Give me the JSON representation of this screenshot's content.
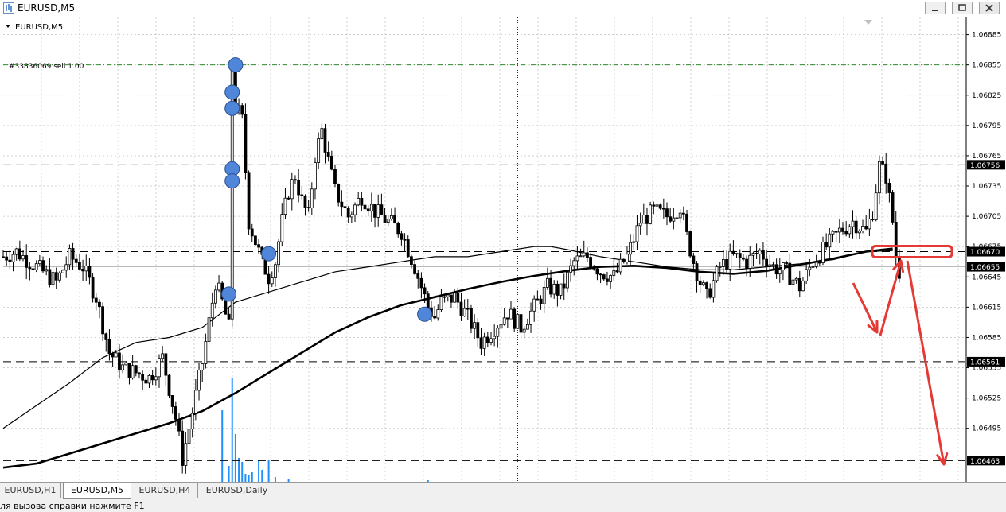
{
  "window": {
    "title": "EURUSD,M5",
    "minimize_icon": "minimize-icon",
    "restore_icon": "restore-icon",
    "close_icon": "close-icon"
  },
  "chart_label": "EURUSD,M5",
  "order_label": "#33836069 sell 1.00",
  "tabs": [
    {
      "label": "EURUSD,H1",
      "active": false
    },
    {
      "label": "EURUSD,M5",
      "active": true
    },
    {
      "label": "EURUSD,H4",
      "active": false
    },
    {
      "label": "EURUSD,Daily",
      "active": false
    }
  ],
  "status_text": "ля вызова справки нажмите F1",
  "colors": {
    "candle": "#000000",
    "grid": "#c8c8c8",
    "order_line": "#2e8b2e",
    "volume": "#1e90ff",
    "marker": "#4f86d9",
    "annotation": "#e53935",
    "price_tag": "#000000"
  },
  "chart_data": {
    "type": "candlestick",
    "symbol": "EURUSD",
    "timeframe": "M5",
    "ylim": [
      1.06442,
      1.06902
    ],
    "y_ticks": [
      "1.06885",
      "1.06855",
      "1.06825",
      "1.06795",
      "1.06765",
      "1.06735",
      "1.06705",
      "1.06675",
      "1.06645",
      "1.06615",
      "1.06585",
      "1.06555",
      "1.06525",
      "1.06495"
    ],
    "price_tags": [
      "1.06756",
      "1.06670",
      "1.06655",
      "1.06561",
      "1.06463"
    ],
    "levels": [
      1.06756,
      1.0667,
      1.06561,
      1.06463
    ],
    "order_level": 1.06855,
    "current_price": 1.06655,
    "grid": true,
    "vertical_crosshair_bar": 155,
    "close_path": [
      [
        0,
        1.06665
      ],
      [
        4,
        1.0667
      ],
      [
        8,
        1.0666
      ],
      [
        12,
        1.0665
      ],
      [
        16,
        1.0664
      ],
      [
        20,
        1.06665
      ],
      [
        24,
        1.06655
      ],
      [
        28,
        1.06625
      ],
      [
        32,
        1.0657
      ],
      [
        36,
        1.06555
      ],
      [
        40,
        1.0655
      ],
      [
        44,
        1.06545
      ],
      [
        48,
        1.06565
      ],
      [
        52,
        1.06505
      ],
      [
        54,
        1.06465
      ],
      [
        56,
        1.06495
      ],
      [
        60,
        1.0656
      ],
      [
        64,
        1.0664
      ],
      [
        66,
        1.0662
      ],
      [
        68,
        1.06595
      ],
      [
        69,
        1.06855
      ],
      [
        70,
        1.06815
      ],
      [
        72,
        1.068
      ],
      [
        74,
        1.067
      ],
      [
        76,
        1.0668
      ],
      [
        78,
        1.0666
      ],
      [
        80,
        1.06645
      ],
      [
        82,
        1.0666
      ],
      [
        84,
        1.067
      ],
      [
        86,
        1.0673
      ],
      [
        88,
        1.06745
      ],
      [
        90,
        1.0672
      ],
      [
        92,
        1.06705
      ],
      [
        94,
        1.06765
      ],
      [
        96,
        1.0679
      ],
      [
        98,
        1.0676
      ],
      [
        100,
        1.0673
      ],
      [
        104,
        1.06705
      ],
      [
        108,
        1.06725
      ],
      [
        112,
        1.0671
      ],
      [
        116,
        1.067
      ],
      [
        120,
        1.0669
      ],
      [
        124,
        1.06655
      ],
      [
        126,
        1.06635
      ],
      [
        128,
        1.06615
      ],
      [
        130,
        1.06605
      ],
      [
        132,
        1.0662
      ],
      [
        136,
        1.06625
      ],
      [
        140,
        1.06605
      ],
      [
        144,
        1.0658
      ],
      [
        148,
        1.06595
      ],
      [
        152,
        1.0661
      ],
      [
        156,
        1.06595
      ],
      [
        160,
        1.06615
      ],
      [
        164,
        1.06635
      ],
      [
        168,
        1.0663
      ],
      [
        172,
        1.0666
      ],
      [
        176,
        1.06665
      ],
      [
        180,
        1.0665
      ],
      [
        184,
        1.06645
      ],
      [
        188,
        1.06665
      ],
      [
        192,
        1.067
      ],
      [
        196,
        1.0671
      ],
      [
        200,
        1.06705
      ],
      [
        204,
        1.06715
      ],
      [
        206,
        1.06685
      ],
      [
        208,
        1.0666
      ],
      [
        210,
        1.0664
      ],
      [
        212,
        1.06625
      ],
      [
        216,
        1.06655
      ],
      [
        220,
        1.06665
      ],
      [
        224,
        1.0666
      ],
      [
        228,
        1.0667
      ],
      [
        232,
        1.06655
      ],
      [
        236,
        1.0665
      ],
      [
        240,
        1.06635
      ],
      [
        244,
        1.0666
      ],
      [
        248,
        1.06675
      ],
      [
        252,
        1.0669
      ],
      [
        256,
        1.067
      ],
      [
        260,
        1.0669
      ],
      [
        262,
        1.0671
      ],
      [
        264,
        1.06755
      ],
      [
        266,
        1.06745
      ],
      [
        268,
        1.067
      ],
      [
        269,
        1.06665
      ],
      [
        270,
        1.0665
      ]
    ],
    "volume_bars": [
      {
        "bar": 66,
        "value": 90
      },
      {
        "bar": 68,
        "value": 20
      },
      {
        "bar": 69,
        "value": 130
      },
      {
        "bar": 70,
        "value": 60
      },
      {
        "bar": 71,
        "value": 30
      },
      {
        "bar": 72,
        "value": 25
      },
      {
        "bar": 73,
        "value": 10
      },
      {
        "bar": 74,
        "value": 8
      },
      {
        "bar": 75,
        "value": 12
      },
      {
        "bar": 77,
        "value": 28
      },
      {
        "bar": 78,
        "value": 15
      },
      {
        "bar": 80,
        "value": 28
      },
      {
        "bar": 82,
        "value": 6
      },
      {
        "bar": 86,
        "value": 4
      },
      {
        "bar": 128,
        "value": 2
      }
    ],
    "series": [
      {
        "kind": "moving-average-thin",
        "points": [
          [
            0,
            1.06495
          ],
          [
            20,
            1.0654
          ],
          [
            30,
            1.06565
          ],
          [
            40,
            1.0658
          ],
          [
            50,
            1.06585
          ],
          [
            60,
            1.06595
          ],
          [
            70,
            1.0662
          ],
          [
            80,
            1.0663
          ],
          [
            90,
            1.0664
          ],
          [
            100,
            1.0665
          ],
          [
            110,
            1.06655
          ],
          [
            120,
            1.0666
          ],
          [
            130,
            1.06665
          ],
          [
            140,
            1.06665
          ],
          [
            150,
            1.0667
          ],
          [
            160,
            1.06675
          ],
          [
            165,
            1.06675
          ],
          [
            170,
            1.06672
          ],
          [
            180,
            1.06665
          ],
          [
            190,
            1.0666
          ],
          [
            200,
            1.06655
          ],
          [
            210,
            1.06652
          ],
          [
            220,
            1.06652
          ],
          [
            230,
            1.06655
          ],
          [
            240,
            1.06658
          ],
          [
            250,
            1.06662
          ],
          [
            260,
            1.0667
          ],
          [
            268,
            1.06671
          ]
        ]
      },
      {
        "kind": "moving-average-thick",
        "points": [
          [
            0,
            1.06456
          ],
          [
            10,
            1.0646
          ],
          [
            20,
            1.0647
          ],
          [
            30,
            1.0648
          ],
          [
            40,
            1.0649
          ],
          [
            50,
            1.065
          ],
          [
            60,
            1.06512
          ],
          [
            70,
            1.0653
          ],
          [
            80,
            1.0655
          ],
          [
            90,
            1.0657
          ],
          [
            100,
            1.0659
          ],
          [
            110,
            1.06605
          ],
          [
            120,
            1.06617
          ],
          [
            130,
            1.06625
          ],
          [
            140,
            1.06633
          ],
          [
            150,
            1.0664
          ],
          [
            160,
            1.06646
          ],
          [
            170,
            1.06651
          ],
          [
            180,
            1.06655
          ],
          [
            190,
            1.06656
          ],
          [
            200,
            1.06654
          ],
          [
            210,
            1.0665
          ],
          [
            220,
            1.06648
          ],
          [
            230,
            1.06651
          ],
          [
            240,
            1.06657
          ],
          [
            250,
            1.06663
          ],
          [
            260,
            1.0667
          ],
          [
            268,
            1.06673
          ]
        ]
      }
    ],
    "trade_markers": [
      {
        "bar": 70,
        "price": 1.06855
      },
      {
        "bar": 69,
        "price": 1.06828
      },
      {
        "bar": 69,
        "price": 1.06812
      },
      {
        "bar": 69,
        "price": 1.06752
      },
      {
        "bar": 69,
        "price": 1.0674
      },
      {
        "bar": 80,
        "price": 1.06668
      },
      {
        "bar": 68,
        "price": 1.06628
      },
      {
        "bar": 127,
        "price": 1.06608
      }
    ]
  }
}
